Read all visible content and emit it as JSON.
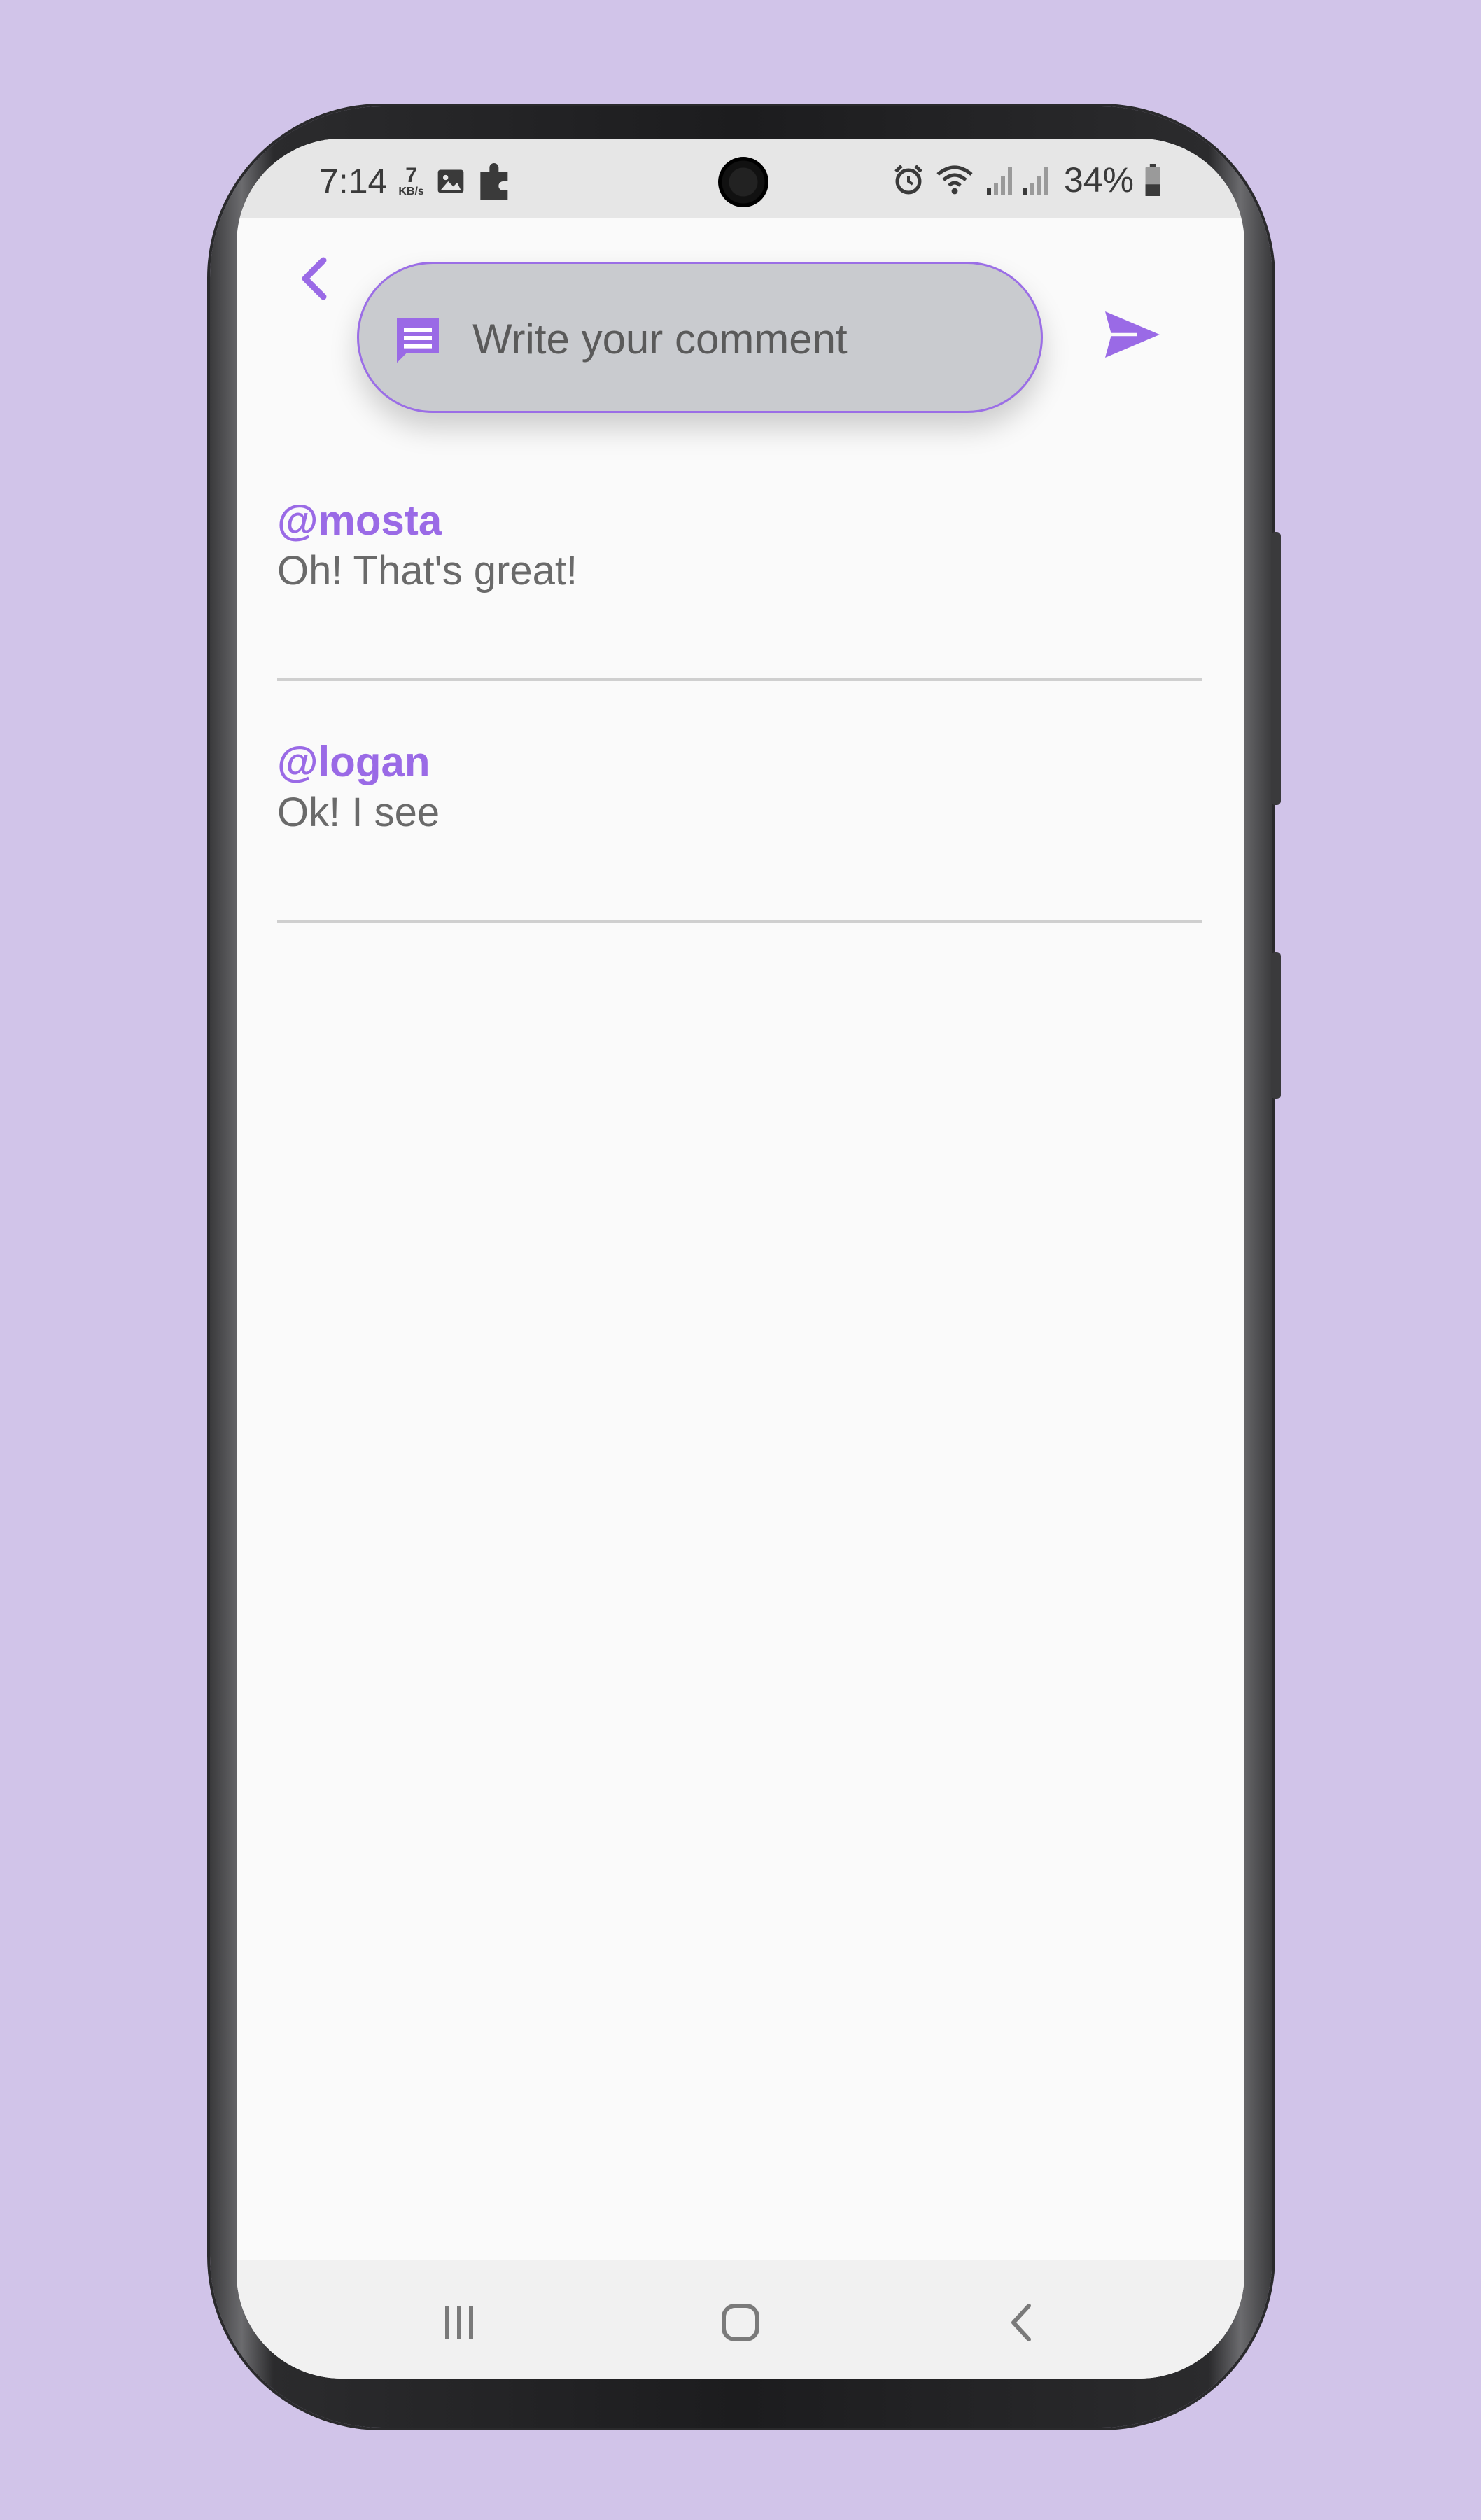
{
  "status_bar": {
    "time": "7:14",
    "net_speed_value": "7",
    "net_speed_unit": "KB/s",
    "battery": "34%",
    "icons": [
      "gallery-icon",
      "puzzle-icon",
      "alarm-icon",
      "wifi-icon",
      "signal-icon",
      "battery-icon"
    ]
  },
  "header": {
    "back_icon": "chevron-left-icon",
    "comment_input": {
      "placeholder": "Write your comment",
      "value": ""
    },
    "comment_icon": "chat-bubble-icon",
    "send_icon": "send-icon"
  },
  "comments": [
    {
      "user": "@mosta",
      "text": "Oh! That's great!"
    },
    {
      "user": "@logan",
      "text": "Ok! I see"
    }
  ],
  "nav_bar": {
    "icons": [
      "recents-icon",
      "home-icon",
      "back-icon"
    ]
  },
  "colors": {
    "accent": "#9a6ae6",
    "background": "#d1c4e9",
    "input_fill": "#c9cbcf"
  }
}
